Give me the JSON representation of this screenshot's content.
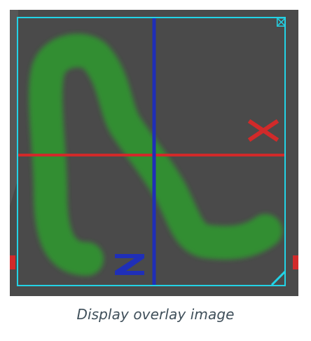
{
  "caption": "Display overlay image",
  "overlay": {
    "x_axis_label": "X",
    "z_axis_label": "Z",
    "colors": {
      "frame": "#22d3e6",
      "x_axis": "#d12a2a",
      "z_axis": "#1f2fb8",
      "stroke": "#2f9a2f",
      "background": "#4a4a4a"
    },
    "icons": {
      "close": "close-box-icon",
      "resize": "resize-handle-icon"
    }
  }
}
